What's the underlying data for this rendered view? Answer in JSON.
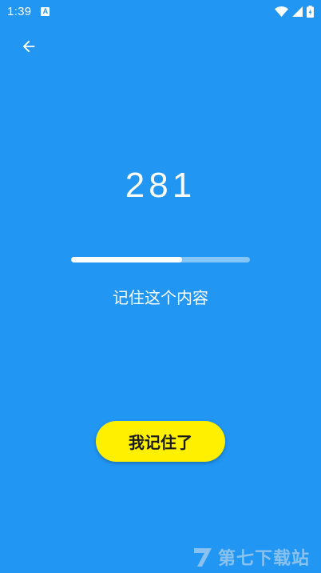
{
  "status_bar": {
    "time": "1:39",
    "notification_letter": "A",
    "icons": [
      "wifi-icon",
      "signal-icon",
      "battery-icon"
    ]
  },
  "toolbar": {
    "back_icon": "arrow-left-icon"
  },
  "main": {
    "number": "281",
    "progress": 0.62,
    "instruction": "记住这个内容"
  },
  "actions": {
    "remembered_label": "我记住了"
  },
  "watermark": {
    "text": "第七下载站"
  },
  "colors": {
    "background": "#2196f3",
    "button": "#fff000",
    "progress_fill": "#ffffff"
  }
}
